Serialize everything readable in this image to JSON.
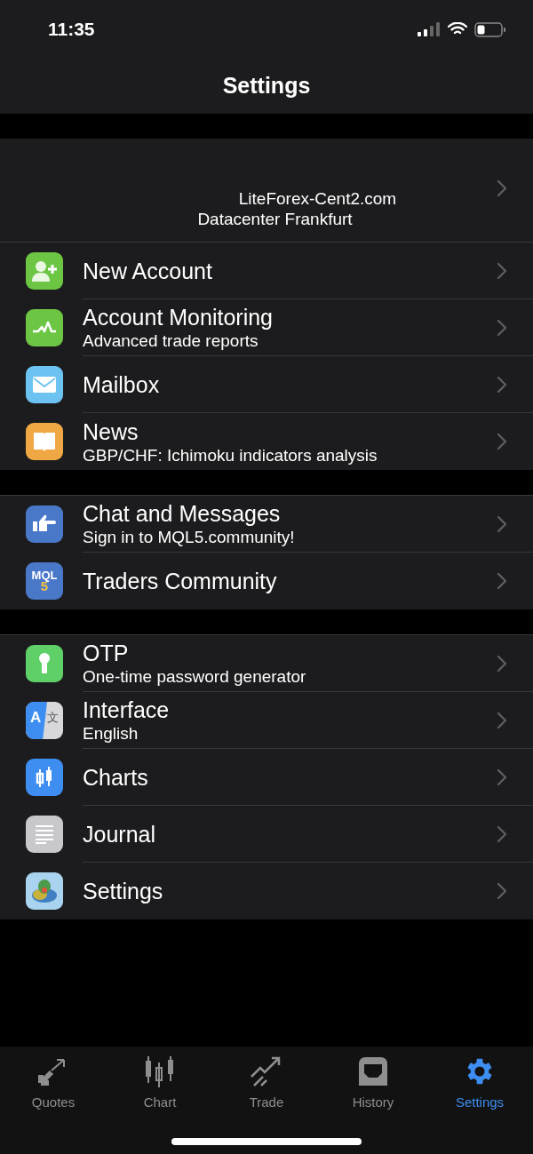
{
  "status_bar": {
    "time": "11:35"
  },
  "header": {
    "title": "Settings"
  },
  "account": {
    "server": "LiteForex-Cent2.com",
    "datacenter": "Datacenter Frankfurt"
  },
  "sections": [
    {
      "items": [
        {
          "title": "New Account"
        },
        {
          "title": "Account Monitoring",
          "subtitle": "Advanced trade reports"
        },
        {
          "title": "Mailbox"
        },
        {
          "title": "News",
          "subtitle": "GBP/CHF: Ichimoku indicators analysis"
        }
      ]
    },
    {
      "items": [
        {
          "title": "Chat and Messages",
          "subtitle": "Sign in to MQL5.community!"
        },
        {
          "title": "Traders Community",
          "icon_text": [
            "MQL",
            "5"
          ]
        }
      ]
    },
    {
      "items": [
        {
          "title": "OTP",
          "subtitle": "One-time password generator"
        },
        {
          "title": "Interface",
          "subtitle": "English",
          "icon_text": [
            "A",
            "文"
          ]
        },
        {
          "title": "Charts"
        },
        {
          "title": "Journal"
        },
        {
          "title": "Settings"
        }
      ]
    }
  ],
  "tab_bar": [
    {
      "label": "Quotes",
      "selected": false
    },
    {
      "label": "Chart",
      "selected": false
    },
    {
      "label": "Trade",
      "selected": false
    },
    {
      "label": "History",
      "selected": false
    },
    {
      "label": "Settings",
      "selected": true
    }
  ]
}
